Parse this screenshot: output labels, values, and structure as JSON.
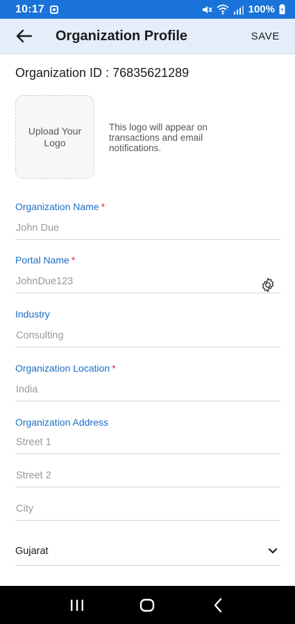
{
  "status_bar": {
    "time": "10:17",
    "battery": "100%"
  },
  "app_bar": {
    "title": "Organization Profile",
    "save_label": "SAVE"
  },
  "organization": {
    "id_label": "Organization ID : 76835621289"
  },
  "logo": {
    "upload_label": "Upload Your Logo",
    "hint": "This logo will appear on transactions and email notifications."
  },
  "fields": {
    "org_name": {
      "label": "Organization Name",
      "required": "*",
      "value": "John Due"
    },
    "portal_name": {
      "label": "Portal Name",
      "required": "*",
      "value": "JohnDue123"
    },
    "industry": {
      "label": "Industry",
      "value": "Consulting"
    },
    "location": {
      "label": "Organization Location",
      "required": "*",
      "value": "India"
    }
  },
  "address": {
    "label": "Organization Address",
    "street1_placeholder": "Street 1",
    "street2_placeholder": "Street 2",
    "city_placeholder": "City",
    "state_value": "Gujarat"
  },
  "colors": {
    "status_bar": "#1a73d9",
    "app_bar": "#e4eefb",
    "label_blue": "#1a6fc7",
    "required_red": "#e12d2d"
  },
  "icons": {
    "back": "arrow-left-icon",
    "gear": "gear-icon",
    "dropdown": "chevron-down-icon"
  }
}
